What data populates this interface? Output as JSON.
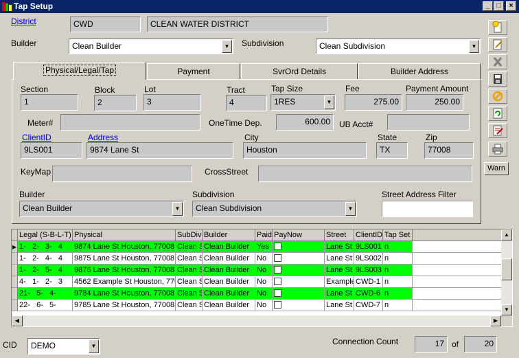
{
  "window": {
    "title": "Tap Setup",
    "colors": {
      "titlebar": "#0a246a",
      "row_green": "#00ff00",
      "link": "#0000ff"
    }
  },
  "header": {
    "district_label": "District",
    "district_code": "CWD",
    "district_name": "CLEAN WATER DISTRICT",
    "builder_label": "Builder",
    "builder_value": "Clean Builder",
    "subdivision_label": "Subdivision",
    "subdivision_value": "Clean Subdivision"
  },
  "tabs": [
    "Physical/Legal/Tap",
    "Payment",
    "SvrOrd Details",
    "Builder Address"
  ],
  "form": {
    "section_label": "Section",
    "section": "1",
    "block_label": "Block",
    "block": "2",
    "lot_label": "Lot",
    "lot": "3",
    "tract_label": "Tract",
    "tract": "4",
    "tapsize_label": "Tap Size",
    "tapsize": "1RES",
    "fee_label": "Fee",
    "fee": "275.00",
    "payment_label": "Payment Amount",
    "payment": "250.00",
    "meter_label": "Meter#",
    "meter": "",
    "onetime_label": "OneTime Dep.",
    "onetime": "600.00",
    "ubacct_label": "UB Acct#",
    "ubacct": "",
    "clientid_label": "ClientID",
    "clientid": "9LS001",
    "address_label": "Address",
    "address": "9874 Lane St",
    "city_label": "City",
    "city": "Houston",
    "state_label": "State",
    "state": "TX",
    "zip_label": "Zip",
    "zip": "77008",
    "keymap_label": "KeyMap",
    "keymap": "",
    "crossstreet_label": "CrossStreet",
    "crossstreet": "",
    "builder_label": "Builder",
    "builder": "Clean Builder",
    "subdivision_label": "Subdivision",
    "subdivision": "Clean Subdivision",
    "filter_label": "Street Address Filter",
    "filter": ""
  },
  "toolbar": {
    "warn_label": "Warn",
    "icons": [
      "new-icon",
      "edit-icon",
      "delete-icon",
      "save-icon",
      "cancel-icon",
      "refresh-icon",
      "report-icon",
      "print-icon"
    ]
  },
  "grid": {
    "columns": [
      "Legal (S-B-L-T)",
      "Physical",
      "SubDiv",
      "Builder",
      "Paid",
      "PayNow",
      "Street",
      "ClientID",
      "Tap Set"
    ],
    "rows": [
      {
        "legal": "1-   2-   3-   4",
        "physical": "9874 Lane St Houston, 77008",
        "subdiv": "Clean S",
        "builder": "Clean Builder",
        "paid": "Yes",
        "street": "Lane St",
        "clientid": "9LS001",
        "tapset": "n",
        "green": true,
        "current": true
      },
      {
        "legal": "1-   2-   4-   4",
        "physical": "9875 Lane St Houston, 77008",
        "subdiv": "Clean S",
        "builder": "Clean Builder",
        "paid": "No",
        "street": "Lane St",
        "clientid": "9LS002",
        "tapset": "n",
        "green": false,
        "current": false
      },
      {
        "legal": "1-   2-   5-   4",
        "physical": "9876 Lane St Houston, 77008",
        "subdiv": "Clean S",
        "builder": "Clean Builder",
        "paid": "No",
        "street": "Lane St",
        "clientid": "9LS003",
        "tapset": "n",
        "green": true,
        "current": false
      },
      {
        "legal": "4-   1-   2-   3",
        "physical": "4562 Example St Houston, 770",
        "subdiv": "Clean S",
        "builder": "Clean Builder",
        "paid": "No",
        "street": "Example",
        "clientid": "CWD-1",
        "tapset": "n",
        "green": false,
        "current": false
      },
      {
        "legal": "21-   5-   4-",
        "physical": "9784 Lane St Houston, 77008",
        "subdiv": "Clean S",
        "builder": "Clean Builder",
        "paid": "No",
        "street": "Lane St",
        "clientid": "CWD-6",
        "tapset": "n",
        "green": true,
        "current": false
      },
      {
        "legal": "22-   6-   5-",
        "physical": "9785 Lane St Houston, 77008",
        "subdiv": "Clean S",
        "builder": "Clean Builder",
        "paid": "No",
        "street": "Lane St",
        "clientid": "CWD-7",
        "tapset": "n",
        "green": false,
        "current": false
      }
    ]
  },
  "footer": {
    "cid_label": "CID",
    "cid_value": "DEMO",
    "conn_label": "Connection Count",
    "conn_current": "17",
    "of_label": "of",
    "conn_max": "20"
  }
}
